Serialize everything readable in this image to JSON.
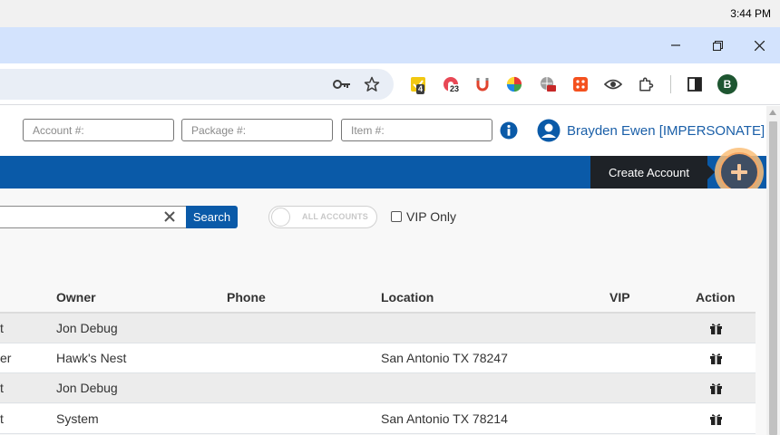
{
  "system": {
    "time": "3:44 PM"
  },
  "extensions": {
    "badge_1": "4",
    "badge_2": "23"
  },
  "profile": {
    "initial": "B"
  },
  "header": {
    "account_placeholder": "Account #:",
    "package_placeholder": "Package #:",
    "item_placeholder": "Item #:",
    "user_name": "Brayden Ewen [IMPERSONATE]"
  },
  "nav": {
    "create_account_tooltip": "Create Account"
  },
  "search": {
    "value": "",
    "button_label": "Search"
  },
  "filters": {
    "all_accounts_label": "ALL ACCOUNTS",
    "vip_only_label": "VIP Only"
  },
  "table": {
    "columns": [
      "Owner",
      "Phone",
      "Location",
      "VIP",
      "Action"
    ],
    "rows": [
      {
        "name_fragment": "t",
        "owner": "Jon Debug",
        "phone": "",
        "location": "",
        "vip": ""
      },
      {
        "name_fragment": "er",
        "owner": "Hawk's Nest",
        "phone": "",
        "location": "San Antonio TX 78247",
        "vip": ""
      },
      {
        "name_fragment": "t",
        "owner": "Jon Debug",
        "phone": "",
        "location": "",
        "vip": ""
      },
      {
        "name_fragment": "t",
        "owner": "System",
        "phone": "",
        "location": "San Antonio TX 78214",
        "vip": ""
      }
    ]
  },
  "colors": {
    "brand_blue": "#0a5aa8",
    "tooltip_bg": "#1e2227",
    "highlight": "#f4a562"
  }
}
